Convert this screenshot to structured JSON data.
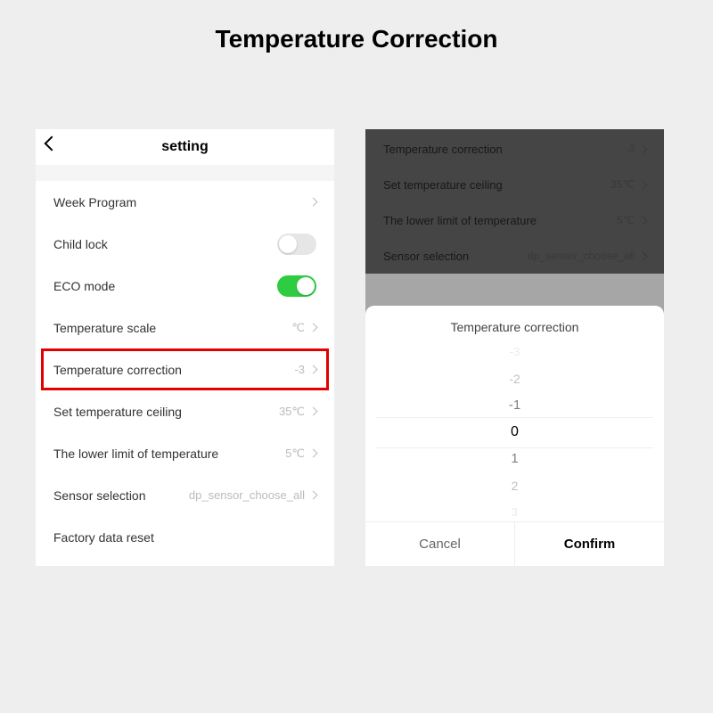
{
  "page_title": "Temperature Correction",
  "left": {
    "nav_title": "setting",
    "rows": {
      "week_program": "Week Program",
      "child_lock": "Child lock",
      "eco_mode": "ECO mode",
      "temp_scale": {
        "label": "Temperature scale",
        "value": "℃"
      },
      "temp_corr": {
        "label": "Temperature correction",
        "value": "-3"
      },
      "ceiling": {
        "label": "Set temperature ceiling",
        "value": "35℃"
      },
      "lower": {
        "label": "The lower limit of temperature",
        "value": "5℃"
      },
      "sensor": {
        "label": "Sensor selection",
        "value": "dp_sensor_choose_all"
      },
      "factory": "Factory data reset"
    },
    "child_lock_on": false,
    "eco_on": true
  },
  "right": {
    "bg_rows": {
      "temp_corr": {
        "label": "Temperature correction",
        "value": "-3"
      },
      "ceiling": {
        "label": "Set temperature ceiling",
        "value": "35℃"
      },
      "lower": {
        "label": "The lower limit of temperature",
        "value": "5℃"
      },
      "sensor": {
        "label": "Sensor selection",
        "value": "dp_sensor_choose_all"
      }
    },
    "sheet_title": "Temperature correction",
    "picker_values": {
      "m3": "-3",
      "m2": "-2",
      "m1": "-1",
      "zero": "0",
      "p1": "1",
      "p2": "2",
      "p3": "3"
    },
    "cancel": "Cancel",
    "confirm": "Confirm"
  }
}
